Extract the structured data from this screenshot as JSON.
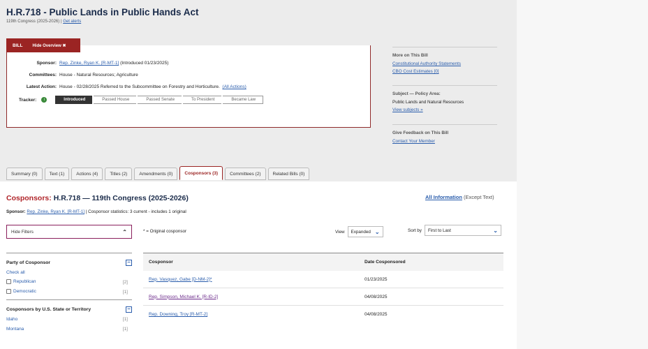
{
  "bill": {
    "title": "H.R.718 - Public Lands in Public Hands Act",
    "congress": "119th Congress (2025-2026)",
    "alerts_link": "Get alerts"
  },
  "overview": {
    "tab_label": "BILL",
    "hide_label": "Hide Overview ✖",
    "sponsor_label": "Sponsor:",
    "sponsor_link": "Rep. Zinke, Ryan K. [R-MT-1]",
    "sponsor_intro": "(Introduced 01/23/2025)",
    "committees_label": "Committees:",
    "committees_value": "House - Natural Resources; Agriculture",
    "latest_label": "Latest Action:",
    "latest_value": "House - 02/28/2025 Referred to the Subcommittee on Forestry and Horticulture.",
    "all_actions": "(All Actions)",
    "tracker_label": "Tracker:",
    "tracker_info": "i",
    "tracker_steps": [
      "Introduced",
      "Passed House",
      "Passed Senate",
      "To President",
      "Became Law"
    ]
  },
  "sidebar": {
    "more_head": "More on This Bill",
    "authority_link": "Constitutional Authority Statements",
    "cbo_link": "CBO Cost Estimates [0]",
    "subject_head": "Subject — Policy Area:",
    "subject_value": "Public Lands and Natural Resources",
    "view_subjects": "View subjects »",
    "feedback_head": "Give Feedback on This Bill",
    "contact_link": "Contact Your Member"
  },
  "tabs": [
    "Summary (0)",
    "Text (1)",
    "Actions (4)",
    "Titles (2)",
    "Amendments (0)",
    "Cosponsors (3)",
    "Committees (2)",
    "Related Bills (0)"
  ],
  "cosponsors": {
    "title_red": "Cosponsors:",
    "title_rest": "H.R.718 — 119th Congress (2025-2026)",
    "all_info": "All Information",
    "except_text": "(Except Text)",
    "sponsor_label": "Sponsor:",
    "sponsor_link": "Rep. Zinke, Ryan K. [R-MT-1]",
    "stats": "| Cosponsor statistics: 3 current - includes 1 original",
    "hide_filters": "Hide Filters",
    "orig_note": "* = Original cosponsor",
    "view_label": "View",
    "view_value": "Expanded",
    "sort_label": "Sort by",
    "sort_value": "First to Last",
    "col_cosponsor": "Cosponsor",
    "col_date": "Date Cosponsored",
    "rows": [
      {
        "name": "Rep. Vasquez, Gabe [D-NM-2]*",
        "date": "01/23/2025"
      },
      {
        "name": "Rep. Simpson, Michael K. [R-ID-2]",
        "date": "04/08/2025"
      },
      {
        "name": "Rep. Downing, Troy [R-MT-2]",
        "date": "04/08/2025"
      }
    ]
  },
  "filters": {
    "party_head": "Party of Cosponsor",
    "check_all": "Check all",
    "republican": "Republican",
    "republican_count": "[2]",
    "democratic": "Democratic",
    "democratic_count": "[1]",
    "state_head": "Cosponsors by U.S. State or Territory",
    "idaho": "Idaho",
    "idaho_count": "[1]",
    "montana": "Montana",
    "montana_count": "[1]"
  }
}
